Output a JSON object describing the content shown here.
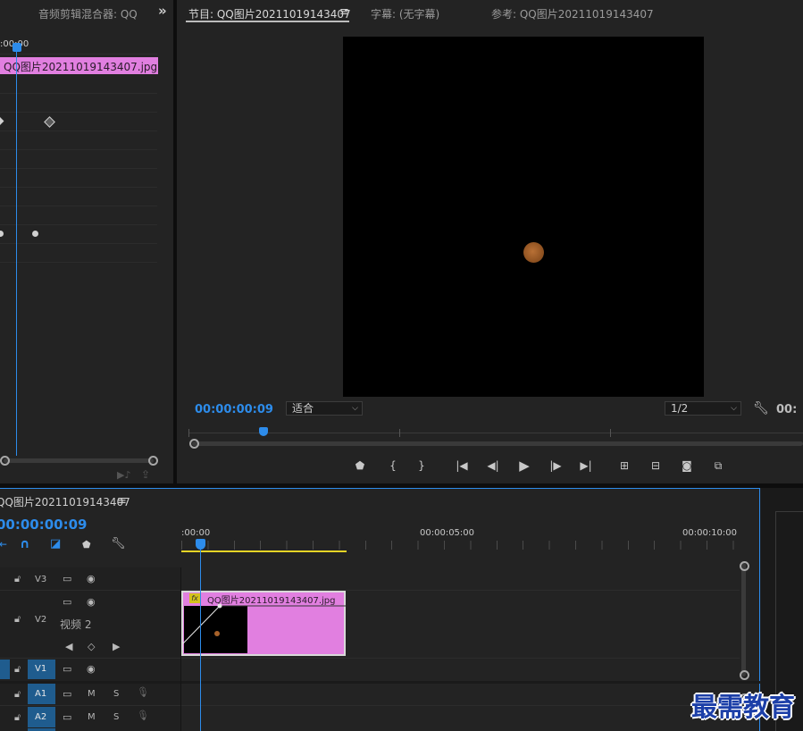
{
  "effect_controls": {
    "tab_title": "音频剪辑混合器: QQ",
    "overflow": "»",
    "ruler_time": ":00:00",
    "clip_label": "QQ图片20211019143407.jpg"
  },
  "program_monitor": {
    "tabs": [
      {
        "label": "节目: QQ图片20211019143407"
      },
      {
        "label": "字幕: (无字幕)"
      },
      {
        "label": "参考: QQ图片20211019143407"
      }
    ],
    "menu_icon": "≡",
    "timecode": "00:00:00:09",
    "fit_value": "适合",
    "resolution_value": "1/2",
    "timecode_right": "00:"
  },
  "timeline": {
    "sequence_name": "QQ图片20211019143407",
    "menu_icon": "≡",
    "timecode": "00:00:00:09",
    "ruler_labels": [
      ":00:00",
      "00:00:05:00",
      "00:00:10:00"
    ],
    "tracks": {
      "v3": "V3",
      "v2": "V2",
      "v2_name": "视频 2",
      "v1": "V1",
      "a1": "A1",
      "a2": "A2",
      "mute": "M",
      "solo": "S"
    },
    "clip": {
      "fx": "fx",
      "label": "QQ图片20211019143407.jpg",
      "color": "#e17fe0"
    }
  },
  "watermark": "最需教育",
  "colors": {
    "accent_blue": "#2d8ceb",
    "clip_pink": "#e17fe0",
    "work_area_yellow": "#e5d426",
    "moon": "#a8622a"
  }
}
